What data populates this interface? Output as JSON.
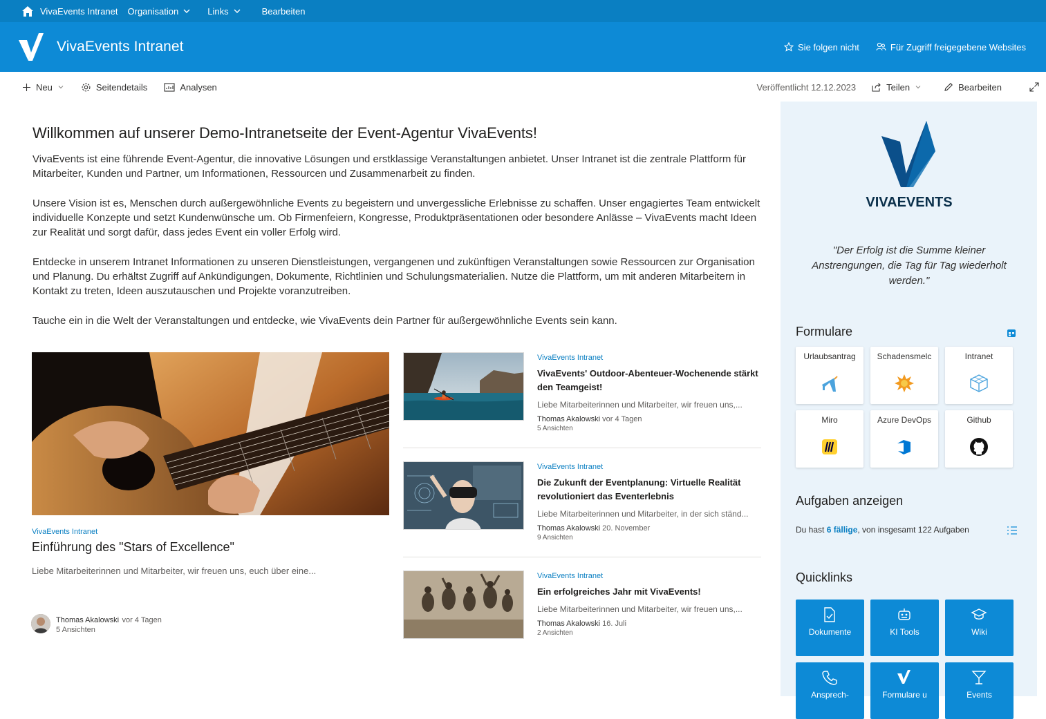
{
  "suitebar": {
    "site": "VivaEvents Intranet",
    "nav": [
      "Organisation",
      "Links"
    ],
    "edit": "Bearbeiten"
  },
  "header": {
    "title": "VivaEvents Intranet",
    "follow": "Sie folgen nicht",
    "shared": "Für Zugriff freigegebene Websites"
  },
  "commandbar": {
    "new": "Neu",
    "details": "Seitendetails",
    "analytics": "Analysen",
    "published": "Veröffentlicht 12.12.2023",
    "share": "Teilen",
    "edit": "Bearbeiten"
  },
  "welcome": {
    "title": "Willkommen auf unserer Demo-Intranetseite der Event-Agentur VivaEvents!",
    "paragraphs": [
      "VivaEvents ist eine führende Event-Agentur, die innovative Lösungen und erstklassige Veranstaltungen anbietet. Unser Intranet ist die zentrale Plattform für Mitarbeiter, Kunden und Partner, um Informationen, Ressourcen und Zusammenarbeit zu finden.",
      "Unsere Vision ist es, Menschen durch außergewöhnliche Events zu begeistern und unvergessliche Erlebnisse zu schaffen. Unser engagiertes Team entwickelt individuelle Konzepte und setzt Kundenwünsche um. Ob Firmenfeiern, Kongresse, Produktpräsentationen oder besondere Anlässe – VivaEvents macht Ideen zur Realität und sorgt dafür, dass jedes Event ein voller Erfolg wird.",
      "Entdecke in unserem Intranet Informationen zu unseren Dienstleistungen, vergangenen und zukünftigen Veranstaltungen sowie Ressourcen zur Organisation und Planung. Du erhältst Zugriff auf Ankündigungen, Dokumente, Richtlinien und Schulungsmaterialien. Nutze die Plattform, um mit anderen Mitarbeitern in Kontakt zu treten, Ideen auszutauschen und Projekte voranzutreiben.",
      "Tauche ein in die Welt der Veranstaltungen und entdecke, wie VivaEvents dein Partner für außergewöhnliche Events sein kann."
    ]
  },
  "hero": {
    "source": "VivaEvents Intranet",
    "title": "Einführung des \"Stars of Excellence\"",
    "desc": "Liebe Mitarbeiterinnen und Mitarbeiter, wir freuen uns, euch über eine...",
    "author": "Thomas Akalowski",
    "when": "vor 4 Tagen",
    "views": "5 Ansichten"
  },
  "news": [
    {
      "source": "VivaEvents Intranet",
      "title": "VivaEvents' Outdoor-Abenteuer-Wochenende stärkt den Teamgeist!",
      "desc": "Liebe Mitarbeiterinnen und Mitarbeiter, wir freuen uns,...",
      "author": "Thomas Akalowski",
      "when": "vor 4 Tagen",
      "views": "5 Ansichten"
    },
    {
      "source": "VivaEvents Intranet",
      "title": "Die Zukunft der Eventplanung: Virtuelle Realität revolutioniert das Eventerlebnis",
      "desc": "Liebe Mitarbeiterinnen und Mitarbeiter, in der sich ständ...",
      "author": "Thomas Akalowski",
      "when": "20. November",
      "views": "9 Ansichten"
    },
    {
      "source": "VivaEvents Intranet",
      "title": "Ein erfolgreiches Jahr mit VivaEvents!",
      "desc": "Liebe Mitarbeiterinnen und Mitarbeiter, wir freuen uns,...",
      "author": "Thomas Akalowski",
      "when": "16. Juli",
      "views": "2 Ansichten"
    }
  ],
  "sidebar": {
    "brand": "VIVAEVENTS",
    "quote": "\"Der Erfolg ist die Summe kleiner Anstrengungen, die Tag für Tag wiederholt werden.\"",
    "forms_title": "Formulare",
    "forms": [
      "Urlaubsantrag",
      "Schadensmelc",
      "Intranet",
      "Miro",
      "Azure DevOps",
      "Github"
    ],
    "tasks_title": "Aufgaben anzeigen",
    "tasks_prefix": "Du hast",
    "tasks_due": "6 fällige",
    "tasks_suffix": ", von insgesamt 122 Aufgaben",
    "quicklinks_title": "Quicklinks",
    "quicklinks": [
      "Dokumente",
      "KI Tools",
      "Wiki",
      "Ansprech-",
      "Formulare u",
      "Events"
    ]
  },
  "colors": {
    "suitebar": "#0a7fc2",
    "header": "#0d8ad6",
    "pane": "#eaf3fa",
    "brand_dark": "#0b4f8a"
  }
}
